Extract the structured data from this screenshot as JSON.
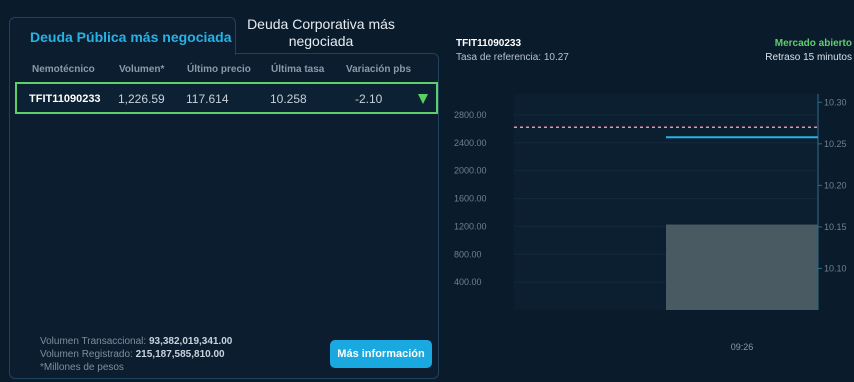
{
  "tabs": {
    "active": "Deuda Pública más negociada",
    "inactive_line1": "Deuda Corporativa más",
    "inactive_line2": "negociada"
  },
  "table": {
    "headers": [
      "Nemotécnico",
      "Volumen*",
      "Último precio",
      "Última tasa",
      "Variación pbs"
    ],
    "row": {
      "ticker": "TFIT11090233",
      "volume": "1,226.59",
      "last_price": "117.614",
      "last_rate": "10.258",
      "variation": "-2.10",
      "trend_icon": "down-triangle-icon"
    }
  },
  "footer": {
    "vol_trans_label": "Volumen Transaccional:",
    "vol_trans_value": "93,382,019,341.00",
    "vol_reg_label": "Volumen Registrado:",
    "vol_reg_value": "215,187,585,810.00",
    "note": "*Millones de pesos",
    "button": "Más información"
  },
  "chart_header": {
    "title": "TFIT11090233",
    "ref_rate": "Tasa de referencia: 10.27",
    "market_status": "Mercado abierto",
    "delay": "Retraso 15 minutos"
  },
  "colors": {
    "accent": "#1aa8e0",
    "positive": "#5fcf6c",
    "ref_line": "#f08fa8",
    "rate_line": "#27b2e6",
    "volume_bar": "#4a5a63"
  },
  "chart_data": {
    "type": "bar",
    "x": [
      "09:26"
    ],
    "left_axis": {
      "ticks": [
        "2800.00",
        "2400.00",
        "2000.00",
        "1600.00",
        "1200.00",
        "800.00",
        "400.00"
      ],
      "range": [
        0,
        3100
      ]
    },
    "right_axis": {
      "ticks": [
        "10.30",
        "10.25",
        "10.20",
        "10.15",
        "10.10"
      ],
      "range": [
        10.05,
        10.31
      ]
    },
    "series": [
      {
        "kind": "bar",
        "axis": "left",
        "values": [
          1226.59
        ]
      },
      {
        "kind": "line",
        "axis": "right",
        "values": [
          10.258
        ]
      }
    ],
    "reference_line": {
      "axis": "right",
      "value": 10.27,
      "style": "dashed"
    }
  }
}
